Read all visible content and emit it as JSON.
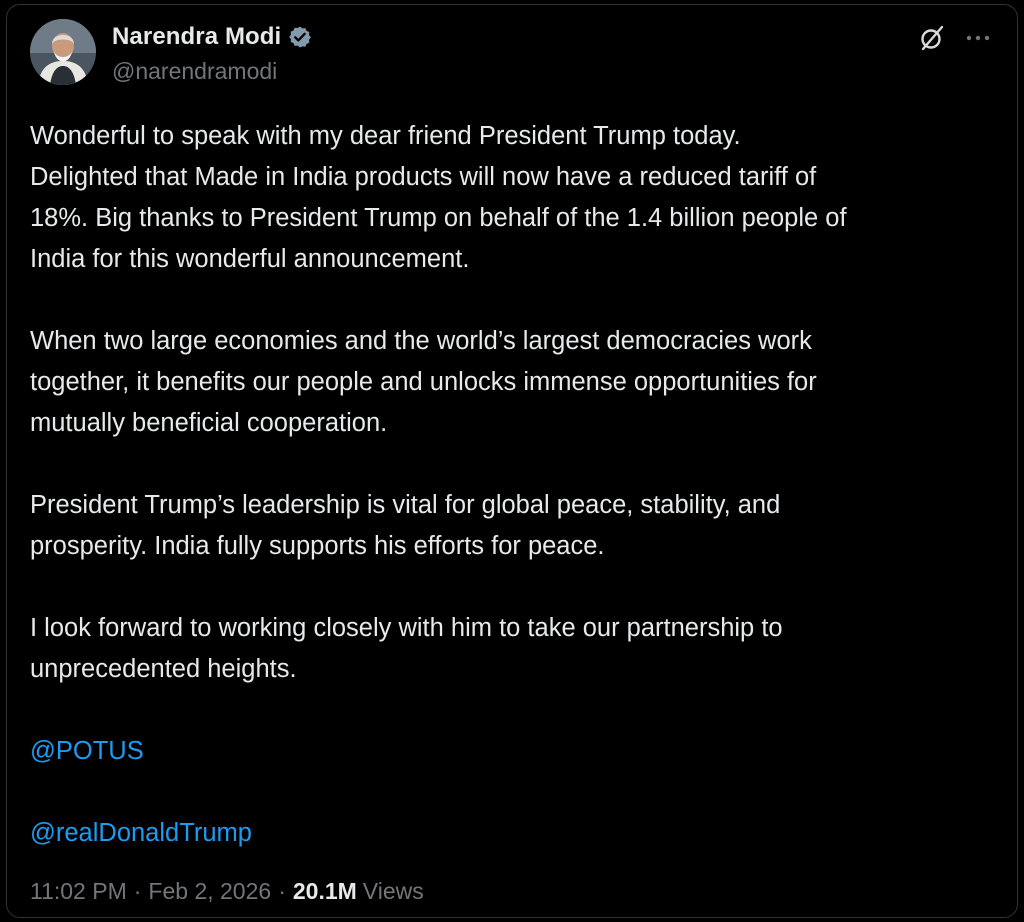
{
  "post": {
    "author": {
      "name": "Narendra Modi",
      "handle": "@narendramodi",
      "verified": true,
      "avatar_icon": "avatar-photo"
    },
    "actions": {
      "grok_icon": "grok-icon",
      "more_icon": "more-options-icon"
    },
    "paragraphs": [
      "Wonderful to speak with my dear friend President Trump today.\nDelighted that Made in India products will now have a reduced tariff of\n18%. Big thanks to President Trump on behalf of the 1.4 billion people of\nIndia for this wonderful announcement.",
      "When two large economies and the world’s largest democracies work\ntogether, it benefits our people and unlocks immense opportunities for\nmutually beneficial cooperation.",
      "President Trump’s leadership is vital for global peace, stability, and\nprosperity. India fully supports his efforts for peace.",
      "I look forward to working closely with him to take our partnership to\nunprecedented heights."
    ],
    "mentions": [
      "@POTUS",
      "@realDonaldTrump"
    ],
    "meta": {
      "time": "11:02 PM",
      "separator": "·",
      "date": "Feb 2, 2026",
      "views_count": "20.1M",
      "views_label": "Views"
    },
    "colors": {
      "background": "#000000",
      "text": "#e7e9ea",
      "secondary": "#71767b",
      "link": "#1d9bf0",
      "verified_badge": "#829aab"
    }
  }
}
